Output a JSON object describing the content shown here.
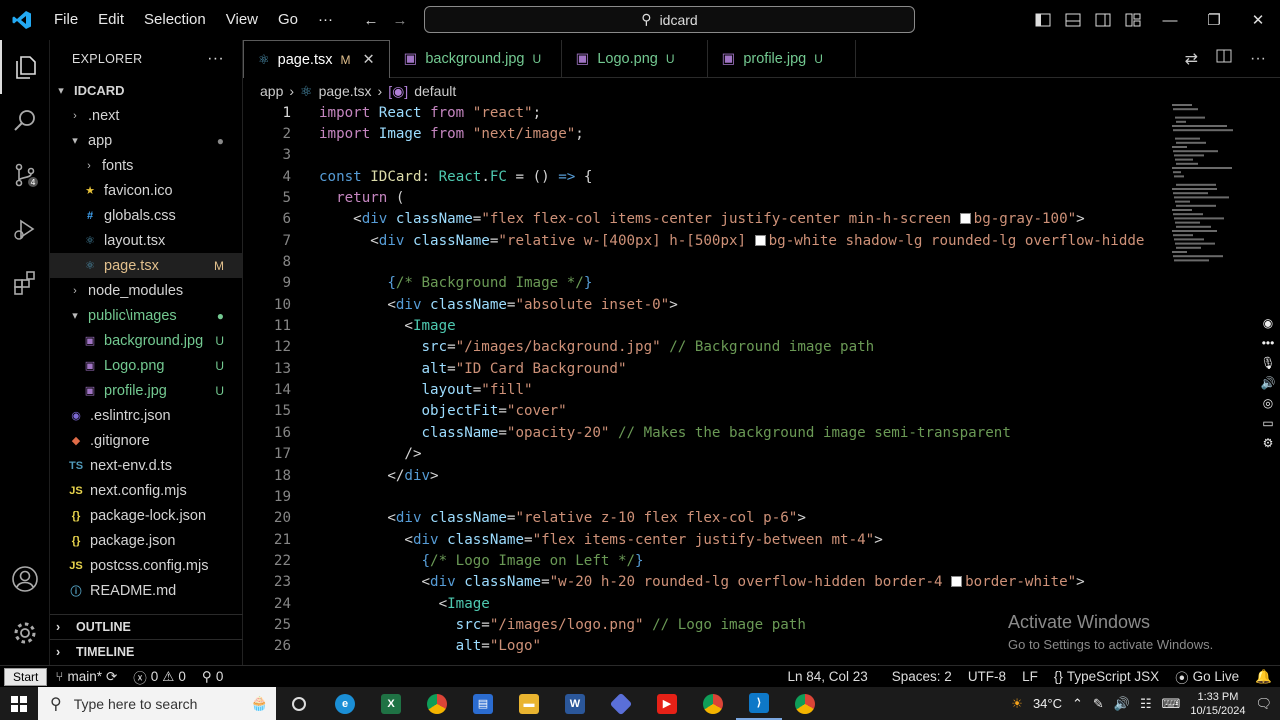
{
  "title_bar": {
    "menus": [
      "File",
      "Edit",
      "Selection",
      "View",
      "Go"
    ],
    "more": "···",
    "search_text": "idcard"
  },
  "explorer": {
    "header": "EXPLORER",
    "more": "···",
    "root": "IDCARD",
    "items": [
      {
        "label": ".next",
        "type": "folder",
        "open": false,
        "depth": 1,
        "badge": ""
      },
      {
        "label": "app",
        "type": "folder",
        "open": true,
        "depth": 1,
        "badge": "●"
      },
      {
        "label": "fonts",
        "type": "folder",
        "open": false,
        "depth": 2,
        "badge": ""
      },
      {
        "label": "favicon.ico",
        "type": "star",
        "depth": 2,
        "badge": ""
      },
      {
        "label": "globals.css",
        "type": "css",
        "depth": 2,
        "badge": ""
      },
      {
        "label": "layout.tsx",
        "type": "tsx",
        "depth": 2,
        "badge": ""
      },
      {
        "label": "page.tsx",
        "type": "tsx",
        "depth": 2,
        "badge": "M",
        "selected": true
      },
      {
        "label": "node_modules",
        "type": "folder",
        "open": false,
        "depth": 1,
        "badge": ""
      },
      {
        "label": "public\\images",
        "type": "folder",
        "open": true,
        "depth": 1,
        "badge": "●"
      },
      {
        "label": "background.jpg",
        "type": "img",
        "depth": 2,
        "badge": "U"
      },
      {
        "label": "Logo.png",
        "type": "img",
        "depth": 2,
        "badge": "U"
      },
      {
        "label": "profile.jpg",
        "type": "img",
        "depth": 2,
        "badge": "U"
      },
      {
        "label": ".eslintrc.json",
        "type": "eslint",
        "depth": 1,
        "badge": ""
      },
      {
        "label": ".gitignore",
        "type": "git",
        "depth": 1,
        "badge": ""
      },
      {
        "label": "next-env.d.ts",
        "type": "ts",
        "depth": 1,
        "badge": ""
      },
      {
        "label": "next.config.mjs",
        "type": "js",
        "depth": 1,
        "badge": ""
      },
      {
        "label": "package-lock.json",
        "type": "json",
        "depth": 1,
        "badge": ""
      },
      {
        "label": "package.json",
        "type": "json",
        "depth": 1,
        "badge": ""
      },
      {
        "label": "postcss.config.mjs",
        "type": "js",
        "depth": 1,
        "badge": ""
      },
      {
        "label": "README.md",
        "type": "info",
        "depth": 1,
        "badge": ""
      }
    ],
    "outline": "OUTLINE",
    "timeline": "TIMELINE"
  },
  "tabs": [
    {
      "label": "page.tsx",
      "badge": "M",
      "active": true
    },
    {
      "label": "background.jpg",
      "badge": "U",
      "active": false
    },
    {
      "label": "Logo.png",
      "badge": "U",
      "active": false
    },
    {
      "label": "profile.jpg",
      "badge": "U",
      "active": false
    }
  ],
  "breadcrumb": [
    "app",
    "page.tsx",
    "default"
  ],
  "code_lines": [
    {
      "n": "1",
      "html": "<span class='kwc'>import</span> <span class='var'>React</span> <span class='kwc'>from</span> <span class='str'>\"react\"</span>;"
    },
    {
      "n": "2",
      "html": "<span class='kwc'>import</span> <span class='var'>Image</span> <span class='kwc'>from</span> <span class='str'>\"next/image\"</span>;"
    },
    {
      "n": "3",
      "html": ""
    },
    {
      "n": "4",
      "html": "<span class='kw'>const</span> <span class='fn'>IDCard</span>: <span class='typ'>React</span>.<span class='typ'>FC</span> = () <span class='kw'>=&gt;</span> {"
    },
    {
      "n": "5",
      "html": "  <span class='kwc'>return</span> ("
    },
    {
      "n": "6",
      "html": "    &lt;<span class='tag'>div</span> <span class='attr'>className</span>=<span class='str'>\"flex flex-col items-center justify-center min-h-screen <span class='sw'></span>bg-gray-100\"</span>&gt;"
    },
    {
      "n": "7",
      "html": "      &lt;<span class='tag'>div</span> <span class='attr'>className</span>=<span class='str'>\"relative w-[400px] h-[500px] <span class='sw'></span>bg-white shadow-lg rounded-lg overflow-hidde</span>"
    },
    {
      "n": "8",
      "html": ""
    },
    {
      "n": "9",
      "html": "        <span class='kw'>{</span><span class='cmt'>/* Background Image */</span><span class='kw'>}</span>"
    },
    {
      "n": "10",
      "html": "        &lt;<span class='tag'>div</span> <span class='attr'>className</span>=<span class='str'>\"absolute inset-0\"</span>&gt;"
    },
    {
      "n": "11",
      "html": "          &lt;<span class='typ'>Image</span>"
    },
    {
      "n": "12",
      "html": "            <span class='attr'>src</span>=<span class='str'>\"/images/background.jpg\"</span> <span class='cmt'>// Background image path</span>"
    },
    {
      "n": "13",
      "html": "            <span class='attr'>alt</span>=<span class='str'>\"ID Card Background\"</span>"
    },
    {
      "n": "14",
      "html": "            <span class='attr'>layout</span>=<span class='str'>\"fill\"</span>"
    },
    {
      "n": "15",
      "html": "            <span class='attr'>objectFit</span>=<span class='str'>\"cover\"</span>"
    },
    {
      "n": "16",
      "html": "            <span class='attr'>className</span>=<span class='str'>\"opacity-20\"</span> <span class='cmt'>// Makes the background image semi-transparent</span>"
    },
    {
      "n": "17",
      "html": "          /&gt;"
    },
    {
      "n": "18",
      "html": "        &lt;/<span class='tag'>div</span>&gt;"
    },
    {
      "n": "19",
      "html": ""
    },
    {
      "n": "20",
      "html": "        &lt;<span class='tag'>div</span> <span class='attr'>className</span>=<span class='str'>\"relative z-10 flex flex-col p-6\"</span>&gt;"
    },
    {
      "n": "21",
      "html": "          &lt;<span class='tag'>div</span> <span class='attr'>className</span>=<span class='str'>\"flex items-center justify-between mt-4\"</span>&gt;"
    },
    {
      "n": "22",
      "html": "            <span class='kw'>{</span><span class='cmt'>/* Logo Image on Left */</span><span class='kw'>}</span>"
    },
    {
      "n": "23",
      "html": "            &lt;<span class='tag'>div</span> <span class='attr'>className</span>=<span class='str'>\"w-20 h-20 rounded-lg overflow-hidden border-4 <span class='sw'></span>border-white\"</span>&gt;"
    },
    {
      "n": "24",
      "html": "              &lt;<span class='typ'>Image</span>"
    },
    {
      "n": "25",
      "html": "                <span class='attr'>src</span>=<span class='str'>\"/images/logo.png\"</span> <span class='cmt'>// Logo image path</span>"
    },
    {
      "n": "26",
      "html": "                <span class='attr'>alt</span>=<span class='str'>\"Logo\"</span>"
    }
  ],
  "status_bar": {
    "start": "Start",
    "branch": "main*",
    "errors": "0",
    "warnings": "0",
    "ports": "0",
    "position": "Ln 84, Col 23",
    "spaces": "Spaces: 2",
    "encoding": "UTF-8",
    "eol": "LF",
    "language": "TypeScript JSX",
    "golive": "Go Live"
  },
  "watermark": {
    "line1": "Activate Windows",
    "line2": "Go to Settings to activate Windows."
  },
  "taskbar": {
    "search_placeholder": "Type here to search",
    "weather": "34°C",
    "time": "1:33 PM",
    "date": "10/15/2024"
  },
  "colors": {
    "accent": "#007acc",
    "git_untracked": "#73c991",
    "git_modified": "#e2c08d"
  }
}
